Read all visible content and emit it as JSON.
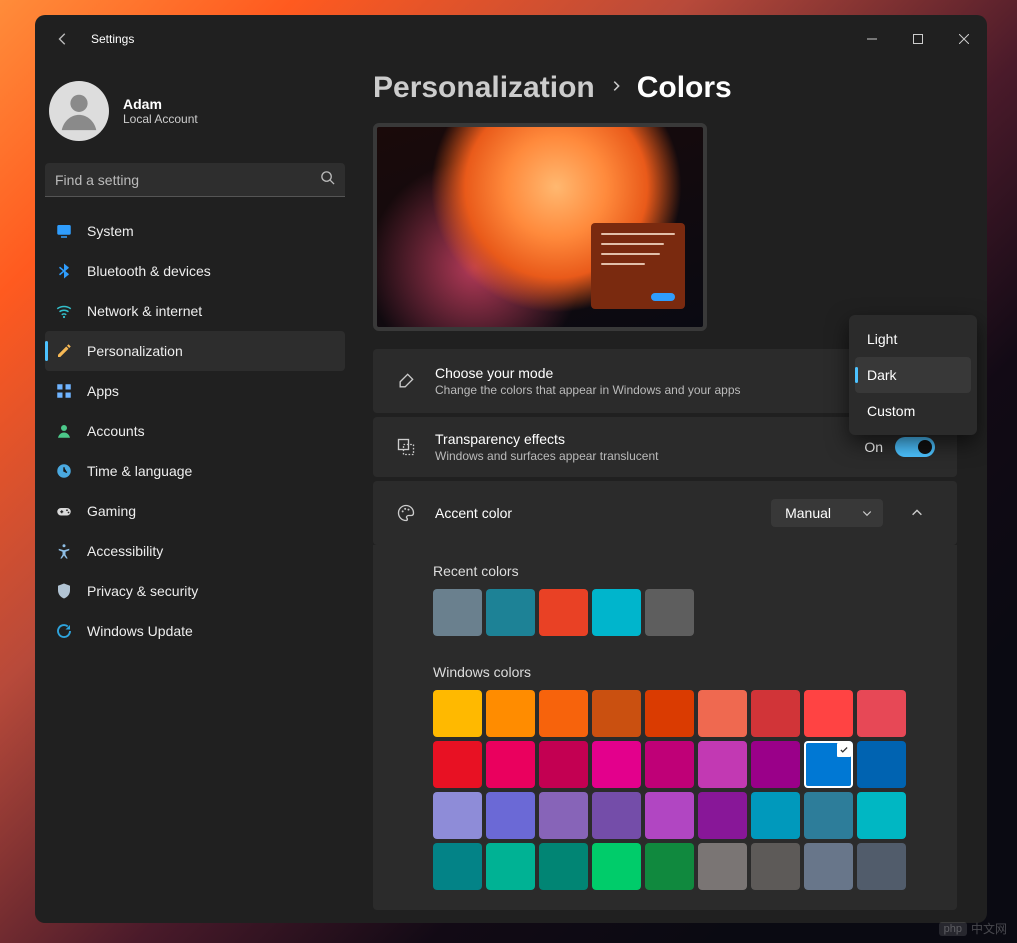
{
  "window": {
    "title": "Settings"
  },
  "user": {
    "name": "Adam",
    "subtitle": "Local Account"
  },
  "search": {
    "placeholder": "Find a setting"
  },
  "nav": {
    "items": [
      {
        "label": "System",
        "icon": "#i-system",
        "color": "#2f9dfd"
      },
      {
        "label": "Bluetooth & devices",
        "icon": "#i-bluetooth",
        "color": "#2f9dfd"
      },
      {
        "label": "Network & internet",
        "icon": "#i-wifi",
        "color": "#33c0cc"
      },
      {
        "label": "Personalization",
        "icon": "#i-personalize",
        "color": "#f7b955"
      },
      {
        "label": "Apps",
        "icon": "#i-apps",
        "color": "#6fb4ff"
      },
      {
        "label": "Accounts",
        "icon": "#i-accounts",
        "color": "#4cc98a"
      },
      {
        "label": "Time & language",
        "icon": "#i-time",
        "color": "#4aa9e0"
      },
      {
        "label": "Gaming",
        "icon": "#i-gaming",
        "color": "#d9d9d9"
      },
      {
        "label": "Accessibility",
        "icon": "#i-accessibility",
        "color": "#8fbfe6"
      },
      {
        "label": "Privacy & security",
        "icon": "#i-privacy",
        "color": "#b2c4d4"
      },
      {
        "label": "Windows Update",
        "icon": "#i-update",
        "color": "#2ea4dd"
      }
    ],
    "active_index": 3
  },
  "breadcrumb": {
    "parent": "Personalization",
    "current": "Colors"
  },
  "mode_card": {
    "title": "Choose your mode",
    "subtitle": "Change the colors that appear in Windows and your apps",
    "options": [
      "Light",
      "Dark",
      "Custom"
    ],
    "selected_index": 1
  },
  "transparency_card": {
    "title": "Transparency effects",
    "subtitle": "Windows and surfaces appear translucent",
    "value_label": "On"
  },
  "accent_card": {
    "title": "Accent color",
    "mode_value": "Manual"
  },
  "recent": {
    "label": "Recent colors",
    "colors": [
      "#6a808e",
      "#1d8296",
      "#e94125",
      "#00b5cc",
      "#5e5e5e"
    ]
  },
  "windows_colors": {
    "label": "Windows colors",
    "selected_index": 16,
    "colors": [
      "#ffb900",
      "#ff8c00",
      "#f7630c",
      "#ca5010",
      "#da3b01",
      "#ef6950",
      "#d13438",
      "#ff4343",
      "#e74856",
      "#e81123",
      "#ea005e",
      "#c30052",
      "#e3008c",
      "#bf0077",
      "#c239b3",
      "#9a0089",
      "#0078d4",
      "#0063b1",
      "#8e8cd8",
      "#6b69d6",
      "#8764b8",
      "#744da9",
      "#b146c2",
      "#881798",
      "#0099bc",
      "#2d7d9a",
      "#00b7c3",
      "#038387",
      "#00b294",
      "#018574",
      "#00cc6a",
      "#10893e",
      "#7a7574",
      "#5d5a58",
      "#68768a",
      "#515c6b"
    ]
  },
  "watermark": {
    "brand": "php",
    "text": "中文网"
  }
}
